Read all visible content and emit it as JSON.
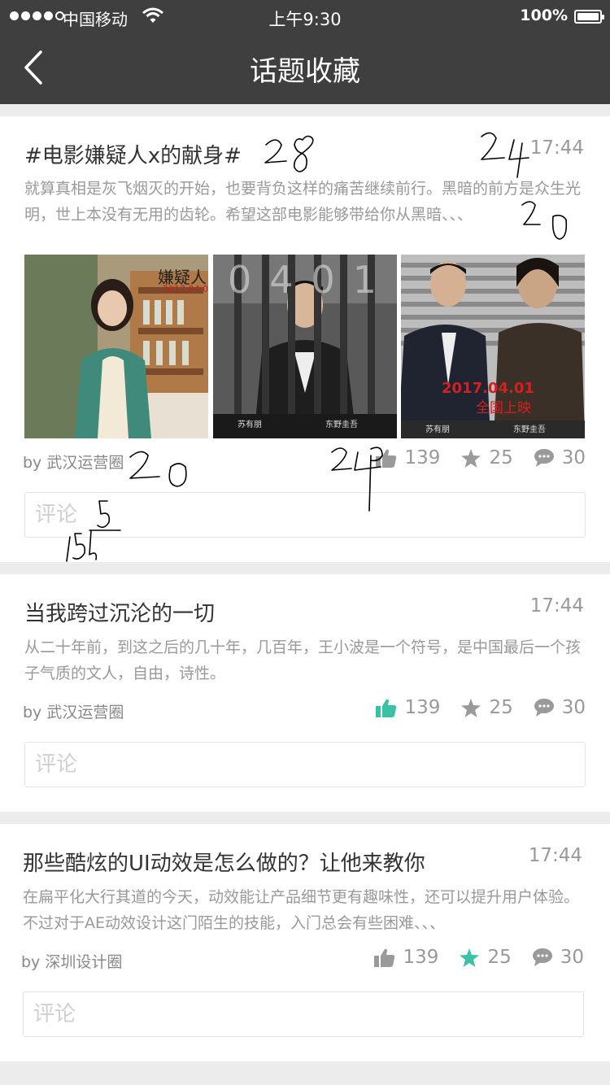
{
  "status_bar": {
    "carrier": "中国移动",
    "time": "上午9:30",
    "battery": "100%"
  },
  "nav": {
    "title": "话题收藏",
    "back_icon": "chevron-left-icon"
  },
  "colors": {
    "bar": "#3f3f3f",
    "accent": "#3cc0a6",
    "muted": "#999999"
  },
  "cards": [
    {
      "title": "#电影嫌疑人x的献身#",
      "time": "17:44",
      "desc": "就算真相是灰飞烟灭的开始，也要背负这样的痛苦继续前行。黑暗的前方是众生光明，世上本没有无用的齿轮。希望这部电影能够带给你从黑暗、、、",
      "images": [
        {
          "poster_title": "嫌疑人",
          "poster_date": "2017.04.0"
        },
        {
          "poster_number": "0401",
          "credit_left": "苏有朋",
          "credit_right": "东野圭吾"
        },
        {
          "poster_date": "2017.04.01",
          "poster_sub": "全国上映",
          "credit_left": "苏有朋",
          "credit_right": "东野圭吾"
        }
      ],
      "byline": "by 武汉运营圈",
      "likes": "139",
      "stars": "25",
      "comments": "30",
      "liked": false,
      "starred": false,
      "comment_placeholder": "评论"
    },
    {
      "title": "当我跨过沉沦的一切",
      "time": "17:44",
      "desc": "从二十年前，到这之后的几十年，几百年，王小波是一个符号，是中国最后一个孩子气质的文人，自由，诗性。",
      "byline": "by 武汉运营圈",
      "likes": "139",
      "stars": "25",
      "comments": "30",
      "liked": true,
      "starred": false,
      "comment_placeholder": "评论"
    },
    {
      "title": "那些酷炫的UI动效是怎么做的？让他来教你",
      "time": "17:44",
      "desc": "在扁平化大行其道的今天，动效能让产品细节更有趣味性，还可以提升用户体验。不过对于AE动效设计这门陌生的技能，入门总会有些困难、、、",
      "byline": "by 深圳设计圈",
      "likes": "139",
      "stars": "25",
      "comments": "30",
      "liked": false,
      "starred": true,
      "comment_placeholder": "评论"
    }
  ],
  "annotations": [
    "28",
    "24",
    "20",
    "20",
    "24",
    "5",
    "15"
  ]
}
